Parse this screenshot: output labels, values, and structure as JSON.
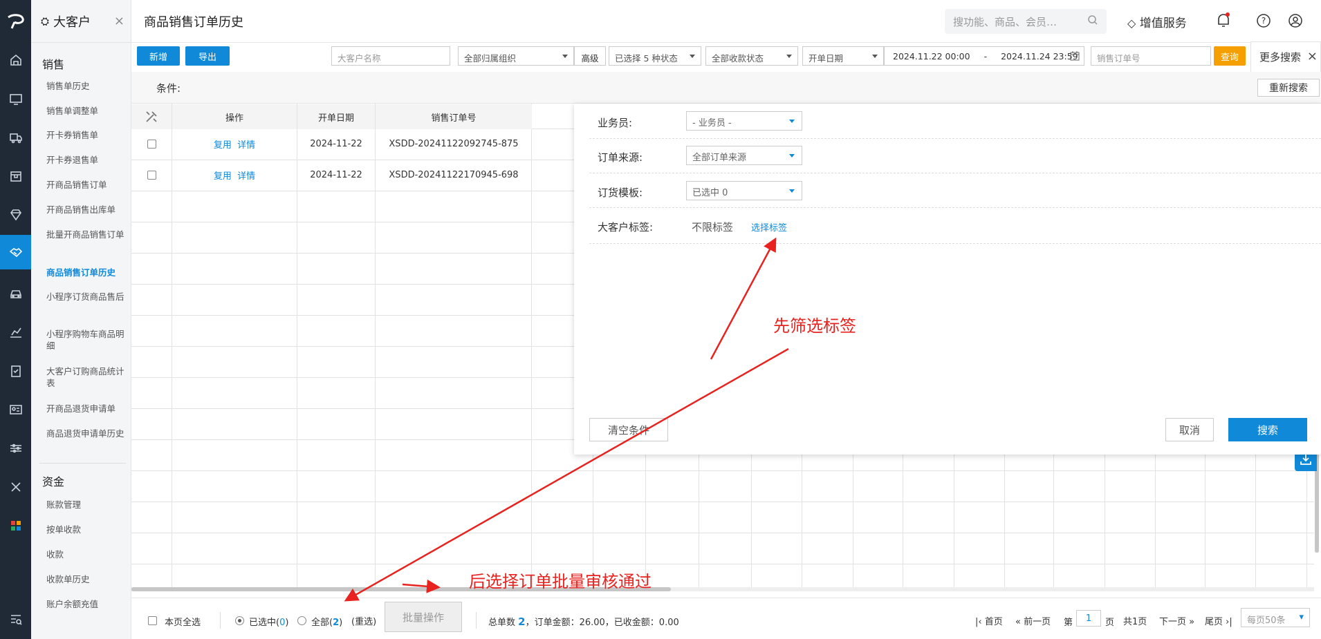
{
  "rail": {
    "icons": [
      "home-icon",
      "monitor-icon",
      "truck-icon",
      "box-icon",
      "diamond-icon",
      "handshake-icon",
      "vehicle-icon",
      "chart-icon",
      "clipboard-icon",
      "idcard-icon",
      "sliders-icon",
      "tools-icon",
      "apps-icon",
      "search-list-icon"
    ]
  },
  "sidebar": {
    "tab_title": "大客户",
    "sections": [
      {
        "title": "销售",
        "items": [
          "销售单历史",
          "销售单调整单",
          "开卡券销售单",
          "开卡券退售单",
          "开商品销售订单",
          "开商品销售出库单",
          "批量开商品销售订单",
          "商品销售订单历史",
          "小程序订货商品售后",
          "小程序购物车商品明细",
          "大客户订购商品统计表",
          "开商品退货申请单",
          "商品退货申请单历史"
        ]
      },
      {
        "title": "资金",
        "items": [
          "账款管理",
          "按单收款",
          "收款",
          "收款单历史",
          "账户余额充值"
        ]
      }
    ],
    "active_item": "商品销售订单历史"
  },
  "header": {
    "title": "商品销售订单历史",
    "search_placeholder": "搜功能、商品、会员…",
    "value_service": "增值服务"
  },
  "toolbar": {
    "new_label": "新增",
    "export_label": "导出",
    "customer_placeholder": "大客户名称",
    "org_select": "全部归属组织",
    "advanced_label": "高级",
    "status_select": "已选择 5 种状态",
    "payment_select": "全部收款状态",
    "date_type": "开单日期",
    "date_start": "2024.11.22 00:00",
    "date_sep": "-",
    "date_end": "2024.11.24 23:59",
    "order_placeholder": "销售订单号",
    "query_label": "查询",
    "more_search": "更多搜索"
  },
  "condition": {
    "label": "条件:",
    "reset_label": "重新搜索"
  },
  "table": {
    "columns": [
      "操作",
      "开单日期",
      "销售订单号"
    ],
    "rows": [
      {
        "action1": "复用",
        "action2": "详情",
        "date": "2024-11-22",
        "order_no": "XSDD-20241122092745-875"
      },
      {
        "action1": "复用",
        "action2": "详情",
        "date": "2024-11-22",
        "order_no": "XSDD-20241122170945-698"
      }
    ]
  },
  "panel": {
    "salesman_label": "业务员:",
    "salesman_value": "- 业务员 -",
    "source_label": "订单来源:",
    "source_value": "全部订单来源",
    "template_label": "订货模板:",
    "template_value": "已选中 0",
    "tag_label": "大客户标签:",
    "tag_value": "不限标签",
    "tag_select": "选择标签",
    "clear_label": "清空条件",
    "cancel_label": "取消",
    "search_label": "搜索"
  },
  "footer": {
    "page_select_all": "本页全选",
    "selected_prefix": "已选中(",
    "selected_count": "0",
    "selected_suffix": ")",
    "all_prefix": "全部(",
    "all_count": "2",
    "all_suffix": ")",
    "reselect": "(重选)",
    "batch_label": "批量操作",
    "total_label": "总单数",
    "total_value": "2",
    "order_amount": "，订单金额：26.00，已收金额：0.00",
    "first": "首页",
    "prev": "前一页",
    "page_prefix": "第",
    "page_value": "1",
    "page_suffix": "页",
    "total_pages": "共1页",
    "next": "下一页",
    "last": "尾页",
    "page_size": "每页50条"
  },
  "annotations": {
    "step1": "先筛选标签",
    "step2": "后选择订单批量审核通过",
    "color": "#e8231f"
  },
  "colors": {
    "accent": "#1089d9",
    "rail": "#1f2a36",
    "query": "#f5a000"
  }
}
